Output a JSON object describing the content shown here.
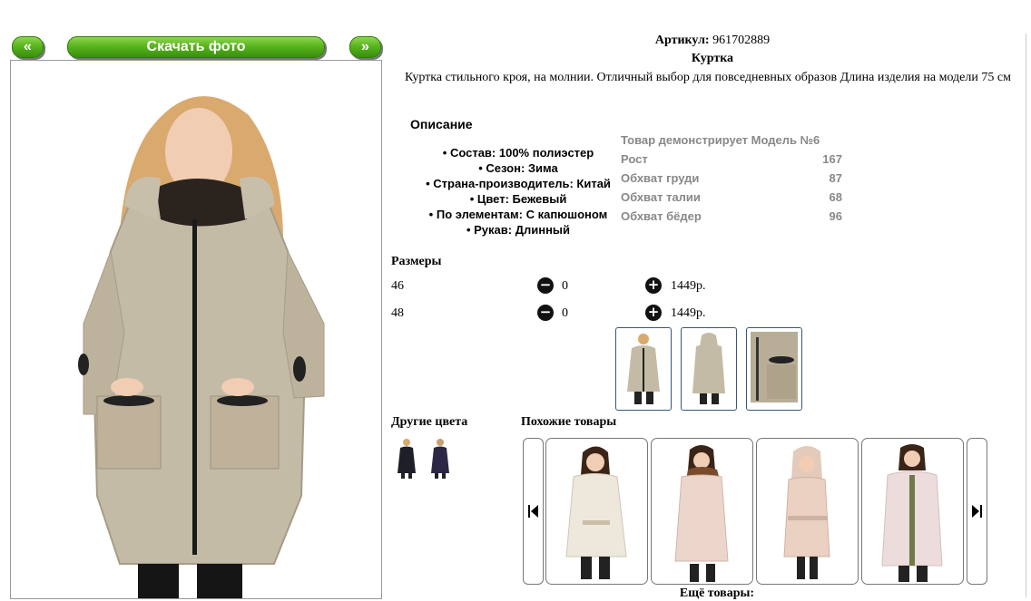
{
  "nav": {
    "prev_label": "«",
    "download_label": "Скачать фото",
    "next_label": "»"
  },
  "product": {
    "article_label": "Артикул:",
    "article_value": "961702889",
    "name": "Куртка",
    "description": "Куртка стильного кроя, на молнии. Отличный выбор для повседневных образов Длина изделия на модели 75 см"
  },
  "specs": {
    "heading": "Описание",
    "items": [
      "Состав: 100% полиэстер",
      "Сезон: Зима",
      "Страна-производитель: Китай",
      "Цвет: Бежевый",
      "По элементам: С капюшоном",
      "Рукав: Длинный"
    ]
  },
  "model": {
    "title": "Товар демонстрирует Модель №6",
    "rows": [
      {
        "label": "Рост",
        "value": "167"
      },
      {
        "label": "Обхват груди",
        "value": "87"
      },
      {
        "label": "Обхват талии",
        "value": "68"
      },
      {
        "label": "Обхват бёдер",
        "value": "96"
      }
    ]
  },
  "sizes": {
    "heading": "Размеры",
    "rows": [
      {
        "size": "46",
        "qty": "0",
        "price": "1449р."
      },
      {
        "size": "48",
        "qty": "0",
        "price": "1449р."
      }
    ]
  },
  "other_colors": {
    "heading": "Другие цвета"
  },
  "similar": {
    "heading": "Похожие товары",
    "more_label": "Ещё товары:"
  },
  "colors": {
    "beige": "#c4bba6",
    "green_button": "#58b51d",
    "thumb_border": "#38577a",
    "spec_grey": "#888888"
  },
  "icons": {
    "minus": "minus-circle-icon",
    "plus": "plus-circle-icon",
    "carousel_prev": "skip-previous-icon",
    "carousel_next": "skip-next-icon"
  }
}
